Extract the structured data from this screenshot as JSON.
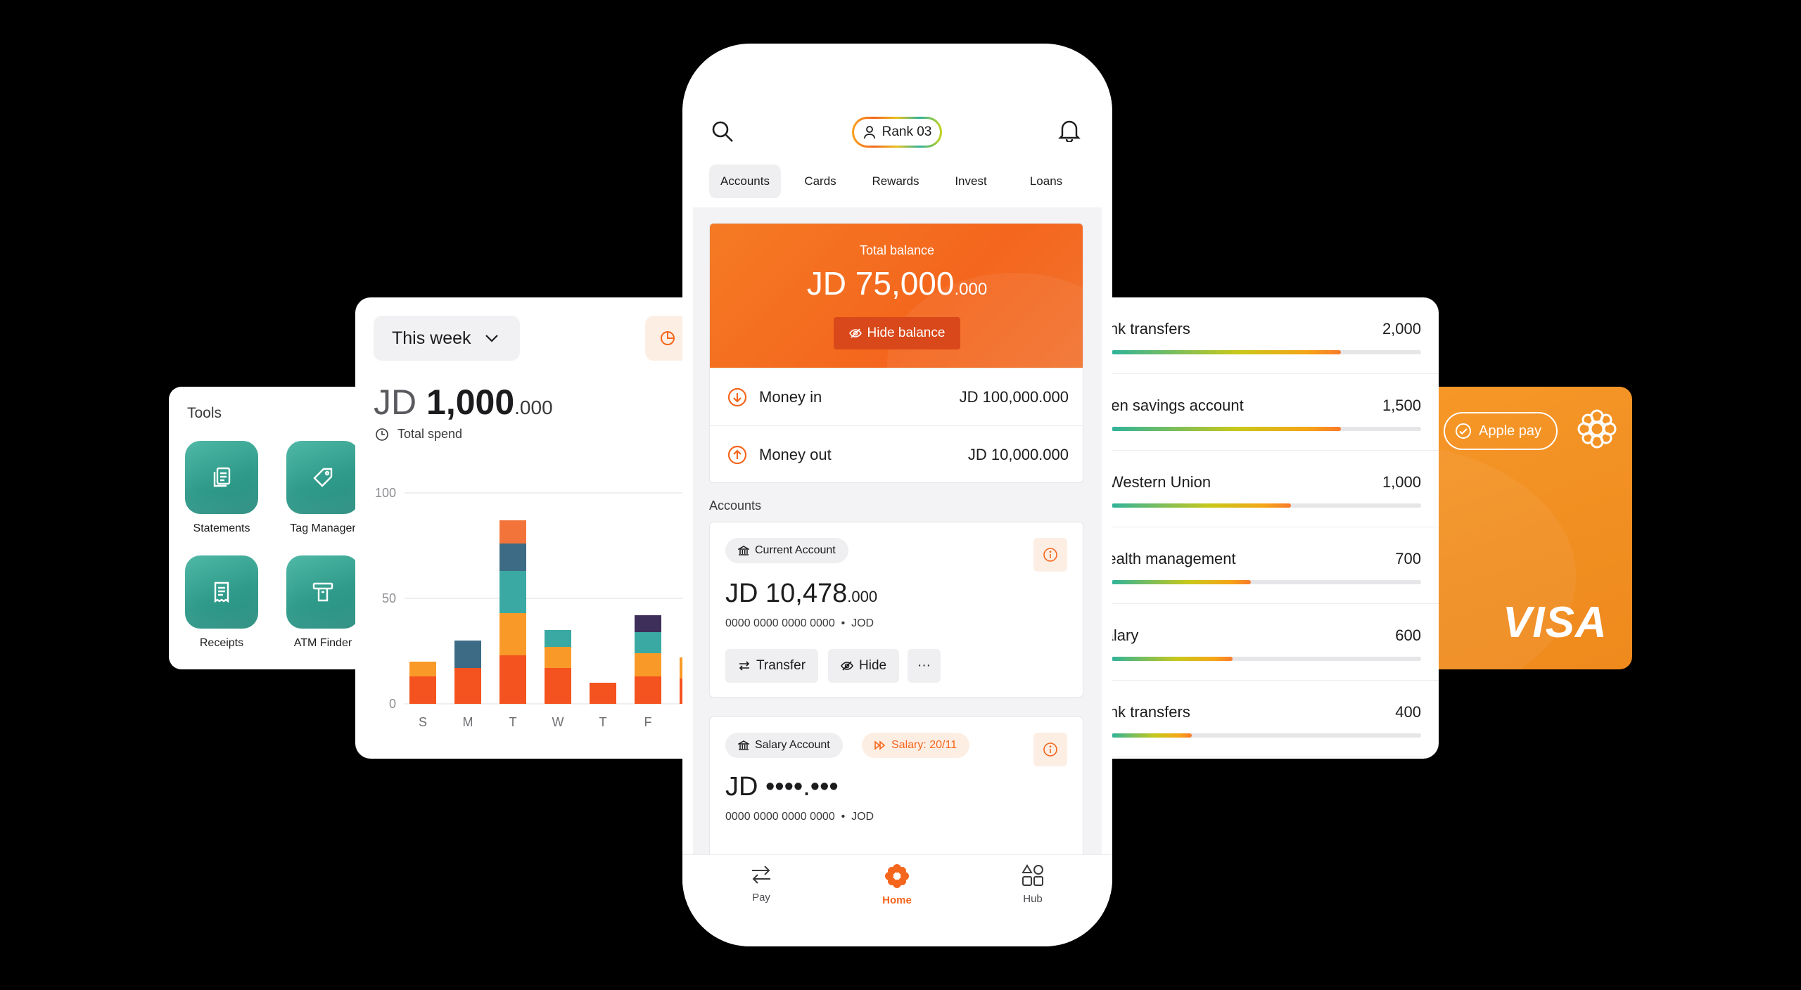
{
  "colors": {
    "accent": "#f4661d",
    "teal": "#2f9a8a",
    "visa_orange": "#f18f22"
  },
  "tools": {
    "title": "Tools",
    "items": [
      {
        "label": "Statements",
        "icon": "documents-icon"
      },
      {
        "label": "Tag Manager",
        "icon": "tag-icon"
      },
      {
        "label": "Receipts",
        "icon": "receipt-icon"
      },
      {
        "label": "ATM Finder",
        "icon": "atm-icon"
      }
    ]
  },
  "spend": {
    "period": "This week",
    "currency": "JD",
    "amount_int": "1,000",
    "amount_dec": ".000",
    "subtitle": "Total spend"
  },
  "chart_data": {
    "type": "bar",
    "stacked": true,
    "categories": [
      "S",
      "M",
      "T",
      "W",
      "T",
      "F",
      "S"
    ],
    "ylim": [
      0,
      100
    ],
    "yticks": [
      "0",
      "50",
      "100"
    ],
    "grid": true,
    "series": [
      {
        "color": "#f4521e",
        "values": [
          13,
          17,
          23,
          17,
          10,
          13,
          12
        ]
      },
      {
        "color": "#f99a28",
        "values": [
          7,
          0,
          20,
          10,
          0,
          11,
          10
        ]
      },
      {
        "color": "#3aa9a3",
        "values": [
          0,
          0,
          20,
          8,
          0,
          10,
          0
        ]
      },
      {
        "color": "#3d6b85",
        "values": [
          0,
          13,
          13,
          0,
          0,
          0,
          0
        ]
      },
      {
        "color": "#3d2e5a",
        "values": [
          0,
          0,
          0,
          0,
          0,
          8,
          0
        ]
      },
      {
        "color": "#f3743a",
        "values": [
          0,
          0,
          11,
          0,
          0,
          0,
          0
        ]
      }
    ]
  },
  "phone": {
    "rank_label": "Rank 03",
    "tabs": [
      "Accounts",
      "Cards",
      "Rewards",
      "Invest",
      "Loans"
    ],
    "balance": {
      "label": "Total balance",
      "amount": "JD 75,000",
      "decimals": ".000",
      "hide_label": "Hide balance"
    },
    "money_in": {
      "label": "Money in",
      "value": "JD 100,000.000"
    },
    "money_out": {
      "label": "Money out",
      "value": "JD 10,000.000"
    },
    "accounts_heading": "Accounts",
    "current": {
      "chip": "Current Account",
      "amount": "JD 10,478",
      "decimals": ".000",
      "number": "0000 0000 0000 0000",
      "currency": "JOD",
      "actions": [
        "Transfer",
        "Hide",
        "···"
      ]
    },
    "salary": {
      "chip": "Salary Account",
      "badge": "Salary: 20/11",
      "amount": "JD ••••.•••",
      "number": "0000 0000 0000 0000",
      "currency": "JOD"
    },
    "nav": [
      "Pay",
      "Home",
      "Hub"
    ]
  },
  "transfers": [
    {
      "label": "Bank transfers",
      "value": "2,000",
      "fraction": 0.74
    },
    {
      "label": "Open savings account",
      "value": "1,500",
      "fraction": 0.74
    },
    {
      "label": "Western Union",
      "value": "1,000",
      "fraction": 0.58
    },
    {
      "label": "Wealth management",
      "value": "700",
      "fraction": 0.45
    },
    {
      "label": "Salary",
      "value": "600",
      "fraction": 0.39
    },
    {
      "label": "Bank transfers",
      "value": "400",
      "fraction": 0.26
    }
  ],
  "card": {
    "apple_pay": "Apple pay",
    "brand": "VISA"
  }
}
